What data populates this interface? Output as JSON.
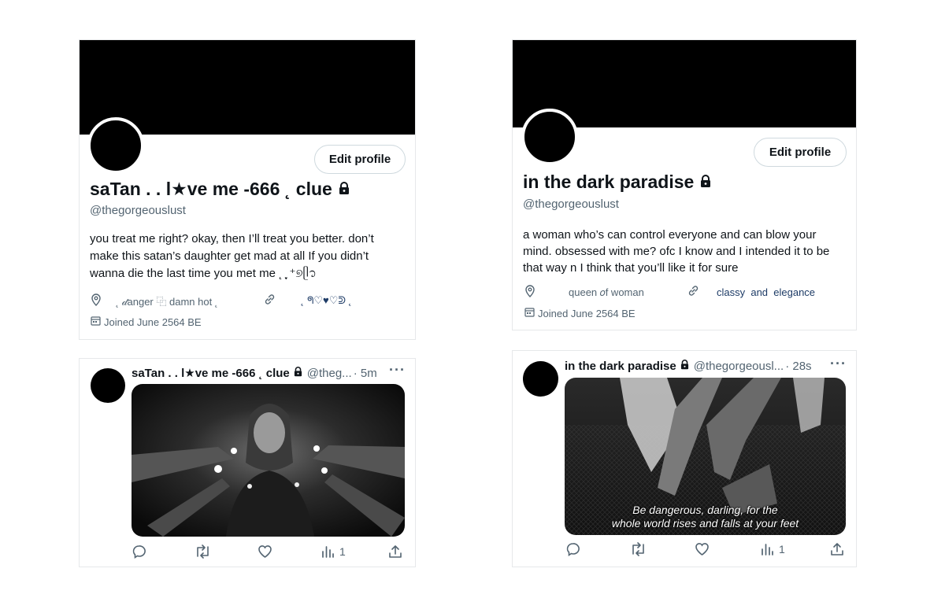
{
  "left_profile": {
    "edit_button": "Edit profile",
    "name": "saTan . . l★ve me -666 ˛ clue",
    "handle": "@thegorgeouslust",
    "bio": "you treat me right? okay, then I’ll treat you better. don’t make this satan’s daughter get mad at all If you didn’t wanna die the last time you met me ˛ ֶָ֢ ⁺୭ᥫ᭡",
    "location": "˛ 𝒹anger ⿻ damn hot ˛",
    "link": "˛ ᖗ♡♥♡ᕲ ˛",
    "joined": "Joined June 2564 BE"
  },
  "right_profile": {
    "edit_button": "Edit profile",
    "name": "in the dark paradise",
    "handle": "@thegorgeouslust",
    "bio": "a woman who’s can control everyone and can blow your mind. obsessed with me? ofc I know and I intended it to be that way n I think that you’ll like it for sure",
    "location": "queen 𝑜f woman",
    "link": "classy  and  elegance",
    "joined": "Joined June 2564 BE"
  },
  "left_tweet": {
    "name": "saTan . . l★ve me -666 ˛ clue",
    "handle": "@theg...",
    "time": "· 5m",
    "views": "1"
  },
  "right_tweet": {
    "name": "in the dark paradise",
    "handle": "@thegorgeousl...",
    "time": "· 28s",
    "views": "1",
    "caption_line1": "Be dangerous, darling, for the",
    "caption_line2": "whole world rises and falls at your feet"
  },
  "icons": [
    "lock-icon",
    "location-icon",
    "link-icon",
    "calendar-icon",
    "reply-icon",
    "retweet-icon",
    "like-icon",
    "views-icon",
    "share-icon",
    "more-icon"
  ],
  "colors": {
    "text": "#0f1419",
    "muted": "#536471",
    "border": "#cfd9de",
    "link": "#1d3b66"
  }
}
